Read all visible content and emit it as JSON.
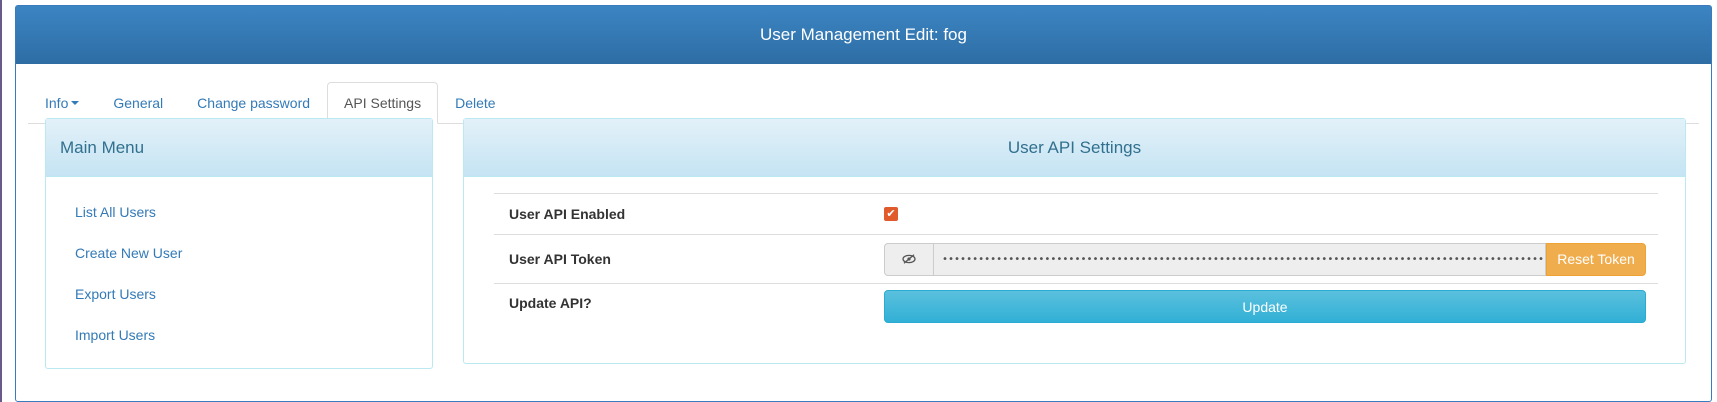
{
  "page": {
    "title": "User Management Edit: fog"
  },
  "tabs": [
    {
      "label": "Info",
      "has_dropdown": true
    },
    {
      "label": "General"
    },
    {
      "label": "Change password"
    },
    {
      "label": "API Settings",
      "active": true
    },
    {
      "label": "Delete"
    }
  ],
  "main_menu": {
    "title": "Main Menu",
    "items": [
      "List All Users",
      "Create New User",
      "Export Users",
      "Import Users"
    ]
  },
  "api_settings": {
    "title": "User API Settings",
    "api_enabled_label": "User API Enabled",
    "api_enabled": true,
    "token_label": "User API Token",
    "token_value": "••••••••••••••••••••••••••••••••••••••••••••••••••••••••••••••••••••••••••••••••••••••••••••••••••••••••••••••••••••••••••••••••••••",
    "eye_icon": "eye-slash-icon",
    "reset_button_label": "Reset Token",
    "update_label": "Update API?",
    "update_button_label": "Update"
  },
  "colors": {
    "header_blue": "#2e6da4",
    "link_blue": "#337ab7",
    "info_heading": "#31708f",
    "warning": "#f0ad4e",
    "info_button": "#5bc0de",
    "checkbox": "#e05a2b"
  }
}
